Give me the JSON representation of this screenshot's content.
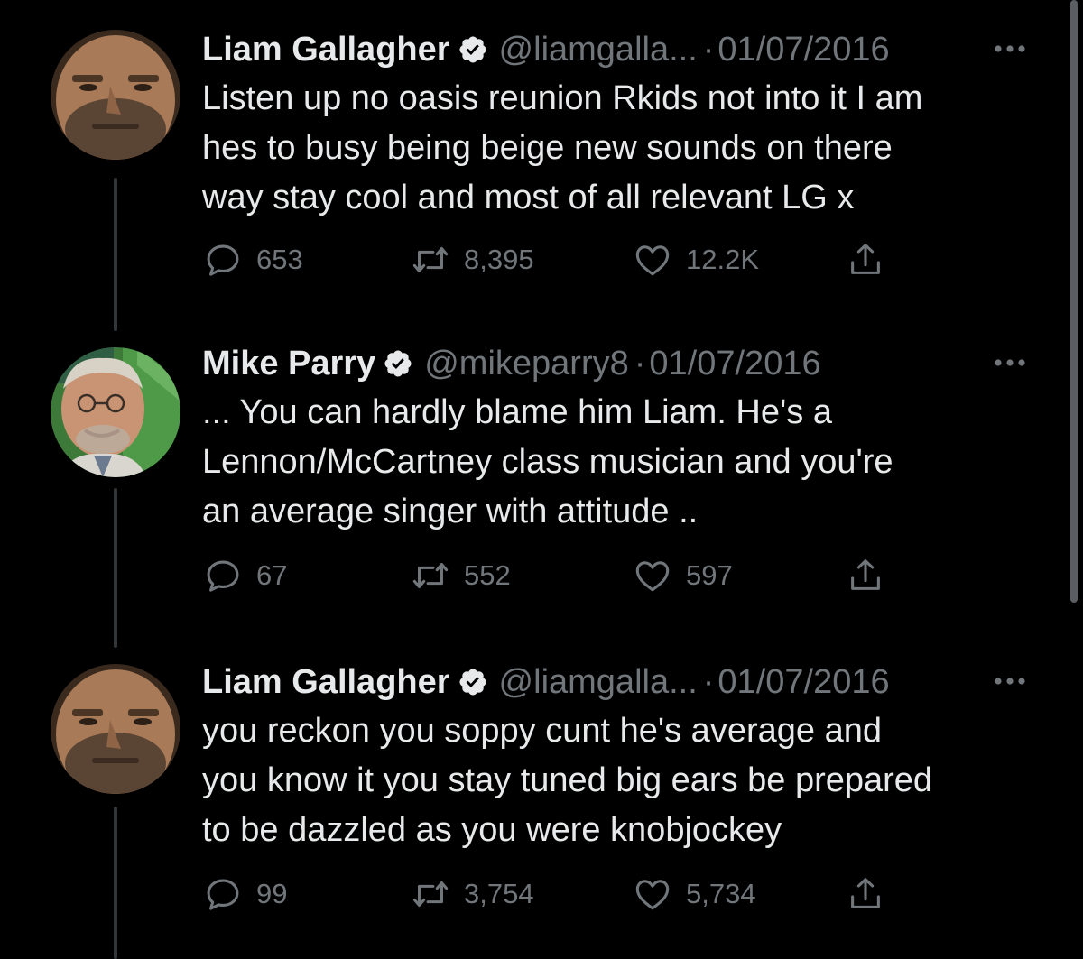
{
  "thread": {
    "tweets": [
      {
        "name": "Liam Gallagher",
        "handle": "@liamgalla...",
        "separator": "·",
        "date": "01/07/2016",
        "text": "Listen up no oasis reunion Rkids not into it I am\nhes to busy being beige new sounds on there\nway stay cool and most of all relevant LG x",
        "replies": "653",
        "retweets": "8,395",
        "likes": "12.2K"
      },
      {
        "name": "Mike Parry",
        "handle": "@mikeparry8",
        "separator": "·",
        "date": "01/07/2016",
        "text": "... You can hardly blame him Liam. He's a\nLennon/McCartney class musician and you're\nan average singer with attitude ..",
        "replies": "67",
        "retweets": "552",
        "likes": "597"
      },
      {
        "name": "Liam Gallagher",
        "handle": "@liamgalla...",
        "separator": "·",
        "date": "01/07/2016",
        "text": "you reckon you soppy cunt he's average and\nyou know it you stay tuned big ears be prepared\nto be dazzled as you were knobjockey",
        "replies": "99",
        "retweets": "3,754",
        "likes": "5,734"
      }
    ]
  },
  "icons": {
    "verified": "verified-badge-icon",
    "more": "more-options-icon",
    "reply": "reply-icon",
    "retweet": "retweet-icon",
    "like": "like-icon",
    "share": "share-icon"
  },
  "colors": {
    "background": "#000000",
    "text": "#e7e9ea",
    "secondary_text": "#71767b",
    "thread_line": "#333639"
  }
}
